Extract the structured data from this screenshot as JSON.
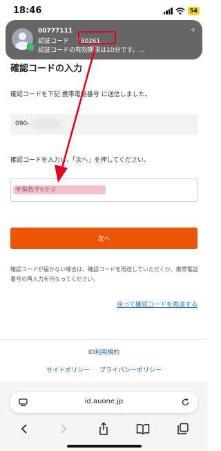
{
  "status_bar": {
    "time": "18:46",
    "battery": "54"
  },
  "notification": {
    "sender": "00777111",
    "line1_prefix": "認証コード",
    "code": "730261",
    "line2": "認証コードの有効期限は10分です。...",
    "time": "今"
  },
  "form": {
    "title": "確認コードの入力",
    "instruction": "確認コードを下記 携帯電話番号 に送信しました。",
    "phone_visible": "090-",
    "instruction2": "確認コードを入力し、「次へ」を押してください。",
    "code_placeholder": "半角数字6ケタ",
    "next_label": "次へ",
    "help_text": "確認コードが届かない場合は、確認コードを再送していただくか、携帯電話番号の再入力を行なってください。",
    "resend_link": "戻って確認コードを再送する"
  },
  "footer": {
    "link_terms": "ID利用規約",
    "link_site_policy": "サイトポリシー",
    "link_privacy": "プライバシーポリシー"
  },
  "browser": {
    "url": "id.auone.jp"
  },
  "colors": {
    "accent": "#eb5505",
    "link": "#1a73c7",
    "annotation_red": "#e4001e"
  },
  "icons": {
    "status": [
      "signal-icon",
      "wifi-icon",
      "battery-icon"
    ],
    "toolbar": [
      "back-icon",
      "forward-icon",
      "share-icon",
      "bookmarks-icon",
      "tabs-icon"
    ],
    "url_bar": [
      "tab-overview-icon",
      "reload-icon"
    ]
  }
}
